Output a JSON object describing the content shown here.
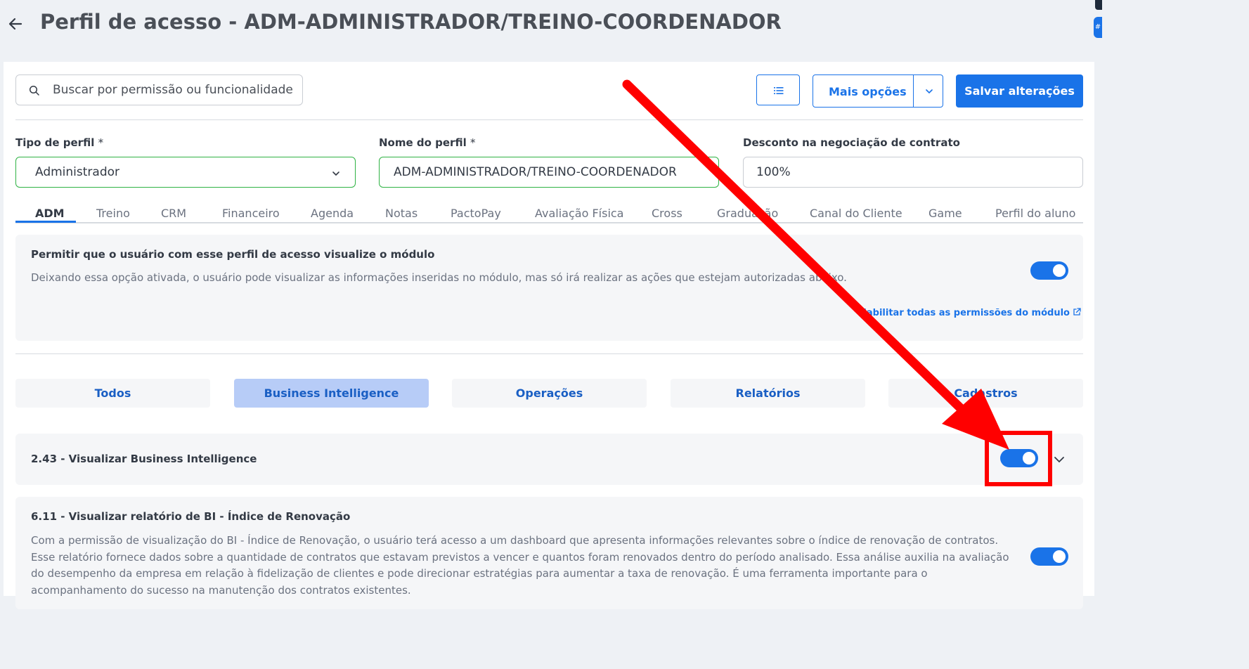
{
  "header": {
    "back_icon": "arrow-left-icon",
    "title": "Perfil de acesso - ADM-ADMINISTRADOR/TREINO-COORDENADOR"
  },
  "toolbar": {
    "search_placeholder": "Buscar por permissão ou funcionalidade",
    "list_icon": "list-icon",
    "more_label": "Mais opções",
    "save_label": "Salvar alterações"
  },
  "form": {
    "profile_type": {
      "label": "Tipo de perfil",
      "required": "*",
      "value": "Administrador"
    },
    "profile_name": {
      "label": "Nome do perfil",
      "required": "*",
      "value": "ADM-ADMINISTRADOR/TREINO-COORDENADOR"
    },
    "discount": {
      "label": "Desconto na negociação de contrato",
      "value": "100%"
    }
  },
  "tabs": [
    {
      "label": "ADM",
      "active": true
    },
    {
      "label": "Treino"
    },
    {
      "label": "CRM"
    },
    {
      "label": "Financeiro"
    },
    {
      "label": "Agenda"
    },
    {
      "label": "Notas"
    },
    {
      "label": "PactoPay"
    },
    {
      "label": "Avaliação Física"
    },
    {
      "label": "Cross"
    },
    {
      "label": "Graduação"
    },
    {
      "label": "Canal do Cliente"
    },
    {
      "label": "Game"
    },
    {
      "label": "Perfil do aluno"
    }
  ],
  "module": {
    "title": "Permitir que o usuário com esse perfil de acesso visualize o módulo",
    "description": "Deixando essa opção ativada, o usuário pode visualizar as informações inseridas no módulo, mas só irá realizar as ações que estejam autorizadas abaixo.",
    "enabled": true,
    "link": "Habilitar todas as permissões do módulo"
  },
  "filters": [
    {
      "label": "Todos"
    },
    {
      "label": "Business Intelligence",
      "active": true
    },
    {
      "label": "Operações"
    },
    {
      "label": "Relatórios"
    },
    {
      "label": "Cadastros"
    }
  ],
  "permissions": [
    {
      "title": "2.43 - Visualizar Business Intelligence",
      "enabled": true
    },
    {
      "title": "6.11 - Visualizar relatório de BI - Índice de Renovação",
      "description": "Com a permissão de visualização do BI - Índice de Renovação, o usuário terá acesso a um dashboard que apresenta informações relevantes sobre o índice de renovação de contratos. Esse relatório fornece dados sobre a quantidade de contratos que estavam previstos a vencer e quantos foram renovados dentro do período analisado. Essa análise auxilia na avaliação do desempenho da empresa em relação à fidelização de clientes e pode direcionar estratégias para aumentar a taxa de renovação. É uma ferramenta importante para o acompanhamento do sucesso na manutenção dos contratos existentes.",
      "enabled": true
    }
  ],
  "colors": {
    "accent": "#1a73e8",
    "annotation": "#ff0000",
    "valid_border": "#2fb344"
  }
}
